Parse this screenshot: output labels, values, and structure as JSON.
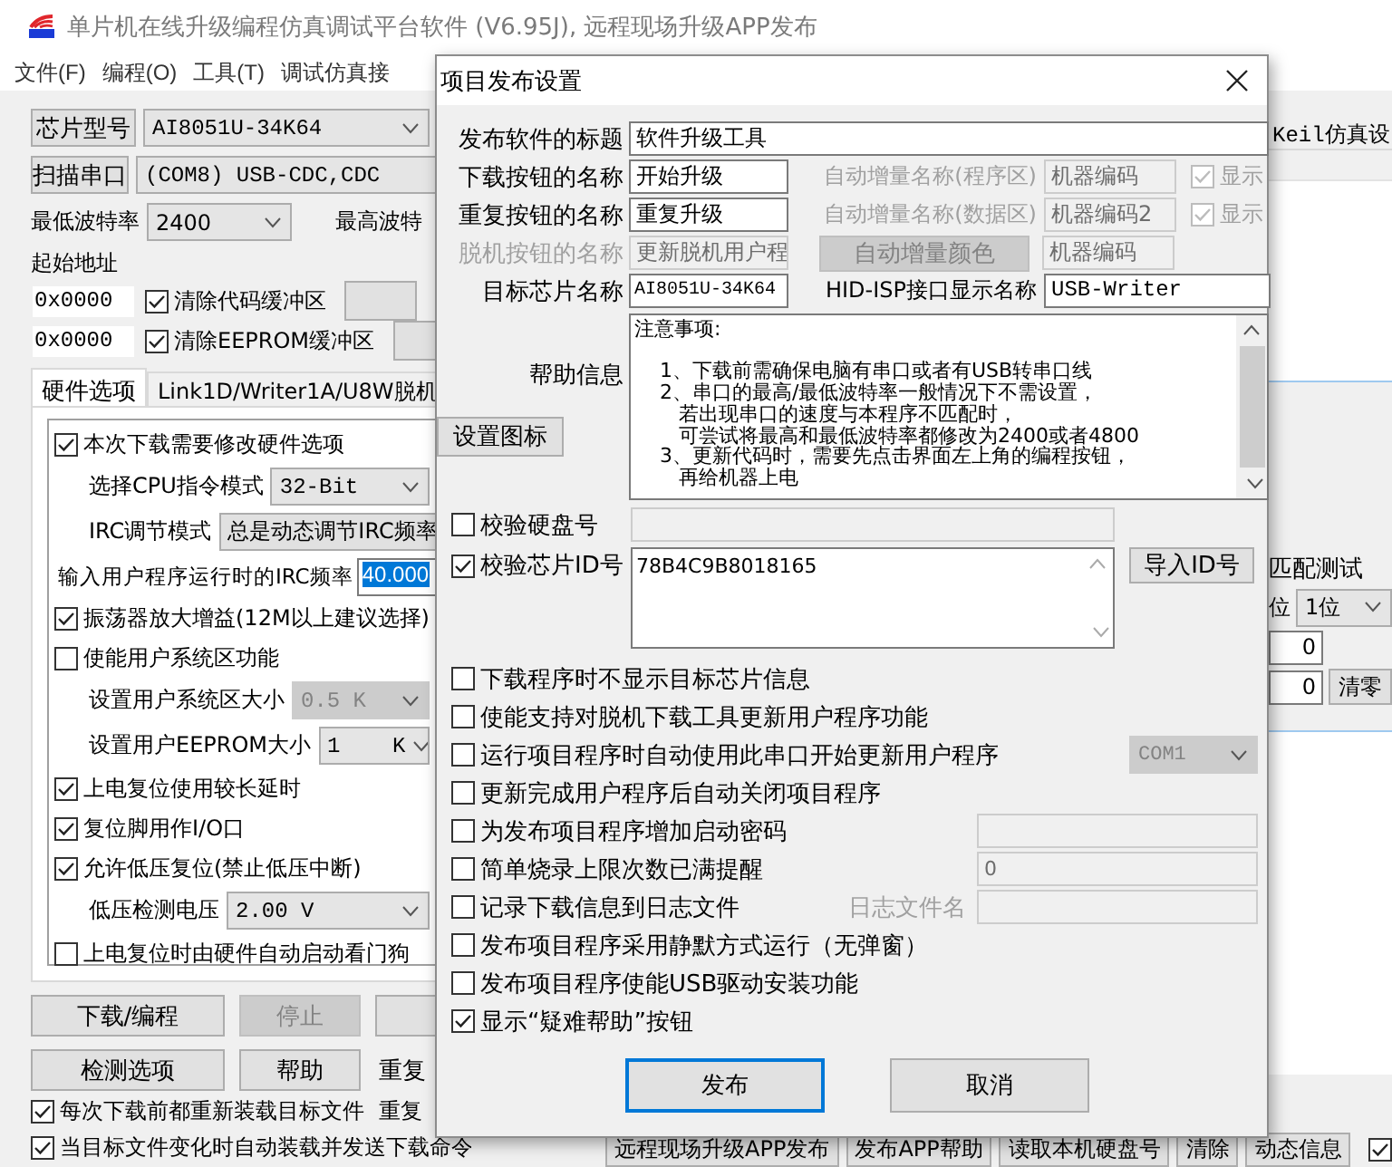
{
  "main_window": {
    "title": "单片机在线升级编程仿真调试平台软件 (V6.95J), 远程现场升级APP发布",
    "menu": [
      "文件(F)",
      "编程(O)",
      "工具(T)",
      "调试仿真接"
    ],
    "chip_button": "芯片型号",
    "chip_model": "AI8051U-34K64",
    "scan_button": "扫描串口",
    "port": "(COM8) USB-CDC,CDC",
    "min_baud_label": "最低波特率",
    "min_baud": "2400",
    "max_baud_label": "最高波特",
    "start_address_label": "起始地址",
    "buffers": [
      {
        "address": "0x0000",
        "label": "清除代码缓冲区",
        "checked": true
      },
      {
        "address": "0x0000",
        "label": "清除EEPROM缓冲区",
        "checked": true
      }
    ],
    "tabs": [
      {
        "label": "硬件选项",
        "selected": true
      },
      {
        "label": "Link1D/Writer1A/U8W脱机",
        "selected": false
      }
    ],
    "hardware_options": [
      {
        "kind": "checkbox",
        "label": "本次下载需要修改硬件选项",
        "checked": true
      },
      {
        "kind": "select",
        "label": "选择CPU指令模式",
        "value": "32-Bit",
        "disabled": false
      },
      {
        "kind": "button",
        "label": "IRC调节模式",
        "value": "总是动态调节IRC频率"
      },
      {
        "kind": "input",
        "label": "输入用户程序运行时的IRC频率",
        "value": "40.000",
        "highlighted": true
      },
      {
        "kind": "checkbox",
        "label": "振荡器放大增益(12M以上建议选择)",
        "checked": true
      },
      {
        "kind": "checkbox",
        "label": "使能用户系统区功能",
        "checked": false
      },
      {
        "kind": "select",
        "label": "设置用户系统区大小",
        "value": "0.5 K",
        "disabled": true
      },
      {
        "kind": "select",
        "label": "设置用户EEPROM大小",
        "value": "1    K",
        "disabled": false
      },
      {
        "kind": "checkbox",
        "label": "上电复位使用较长延时",
        "checked": true
      },
      {
        "kind": "checkbox",
        "label": "复位脚用作I/O口",
        "checked": true
      },
      {
        "kind": "checkbox",
        "label": "允许低压复位(禁止低压中断)",
        "checked": true
      },
      {
        "kind": "select",
        "label": "低压检测电压",
        "value": "2.00 V",
        "disabled": false
      },
      {
        "kind": "checkbox",
        "label": "上电复位时由硬件自动启动看门狗",
        "checked": false
      }
    ],
    "action_buttons": [
      {
        "label": "下载/编程",
        "disabled": false
      },
      {
        "label": "停止",
        "disabled": true
      },
      {
        "label": "检测选项",
        "disabled": false
      },
      {
        "label": "帮助",
        "disabled": false
      }
    ],
    "repeat_labels": [
      "重复",
      "重复"
    ],
    "load_options": [
      {
        "label": "每次下载前都重新装载目标文件",
        "checked": true
      },
      {
        "label": "当目标文件变化时自动装载并发送下载命令",
        "checked": true
      }
    ],
    "right_panel": {
      "tab": {
        "label": "Keil仿真设",
        "selected": false
      },
      "test_label": "匹配测试",
      "digit_label": "位",
      "digit_value": "1位",
      "counters": [
        "0",
        "0"
      ],
      "clear_button": "清零"
    },
    "bottom_buttons": [
      "远程现场升级APP发布",
      "发布APP帮助",
      "读取本机硬盘号",
      "清除",
      "动态信息"
    ],
    "bottom_checkbox": {
      "checked": true
    }
  },
  "dialog": {
    "title": "项目发布设置",
    "app_title": {
      "label": "发布软件的标题",
      "value": "软件升级工具"
    },
    "button_names": [
      {
        "label": "下载按钮的名称",
        "value": "开始升级",
        "auto_label": "自动增量名称(程序区)",
        "auto_value": "机器编码",
        "show_label": "显示",
        "show_checked": true,
        "auto_disabled": true
      },
      {
        "label": "重复按钮的名称",
        "value": "重复升级",
        "auto_label": "自动增量名称(数据区)",
        "auto_value": "机器编码2",
        "show_label": "显示",
        "show_checked": true,
        "auto_disabled": true
      }
    ],
    "offline_button": {
      "label": "脱机按钮的名称",
      "value": "更新脱机用户程",
      "disabled": true,
      "color_button": "自动增量颜色",
      "color_value": "机器编码"
    },
    "chip_name": {
      "label": "目标芯片名称",
      "value": "AI8051U-34K64"
    },
    "hid_name": {
      "label": "HID-ISP接口显示名称",
      "value": "USB-Writer"
    },
    "help": {
      "label": "帮助信息",
      "heading": "注意事项:",
      "lines": [
        "    1、下载前需确保电脑有串口或者有USB转串口线",
        "    2、串口的最高/最低波特率一般情况下不需设置，",
        "       若出现串口的速度与本程序不匹配时，",
        "       可尝试将最高和最低波特率都修改为2400或者4800",
        "    3、更新代码时，需要先点击界面左上角的编程按钮，",
        "       再给机器上电"
      ]
    },
    "icon_button": "设置图标",
    "disk_check": {
      "label": "校验硬盘号",
      "checked": false,
      "field_disabled": true
    },
    "chip_id_check": {
      "label": "校验芯片ID号",
      "checked": true,
      "value": "78B4C9B8018165"
    },
    "import_button": "导入ID号",
    "options": [
      {
        "kind": "plain",
        "label": "下载程序时不显示目标芯片信息",
        "checked": false
      },
      {
        "kind": "plain",
        "label": "使能支持对脱机下载工具更新用户程序功能",
        "checked": false
      },
      {
        "kind": "select",
        "label": "运行项目程序时自动使用此串口开始更新用户程序",
        "checked": false,
        "value": "COM1",
        "disabled": true
      },
      {
        "kind": "plain",
        "label": "更新完成用户程序后自动关闭项目程序",
        "checked": false
      },
      {
        "kind": "field",
        "label": "为发布项目程序增加启动密码",
        "checked": false,
        "disabled": true
      },
      {
        "kind": "field",
        "label": "简单烧录上限次数已满提醒",
        "checked": false,
        "value": "0",
        "disabled": true
      },
      {
        "kind": "field",
        "label": "记录下载信息到日志文件",
        "checked": false,
        "field_label": "日志文件名",
        "disabled": true
      },
      {
        "kind": "plain",
        "label": "发布项目程序采用静默方式运行（无弹窗）",
        "checked": false
      },
      {
        "kind": "plain",
        "label": "发布项目程序使能USB驱动安装功能",
        "checked": false
      },
      {
        "kind": "plain",
        "label": "显示“疑难帮助”按钮",
        "checked": true
      }
    ],
    "buttons": [
      {
        "label": "发布",
        "default": true
      },
      {
        "label": "取消",
        "default": false
      }
    ]
  }
}
